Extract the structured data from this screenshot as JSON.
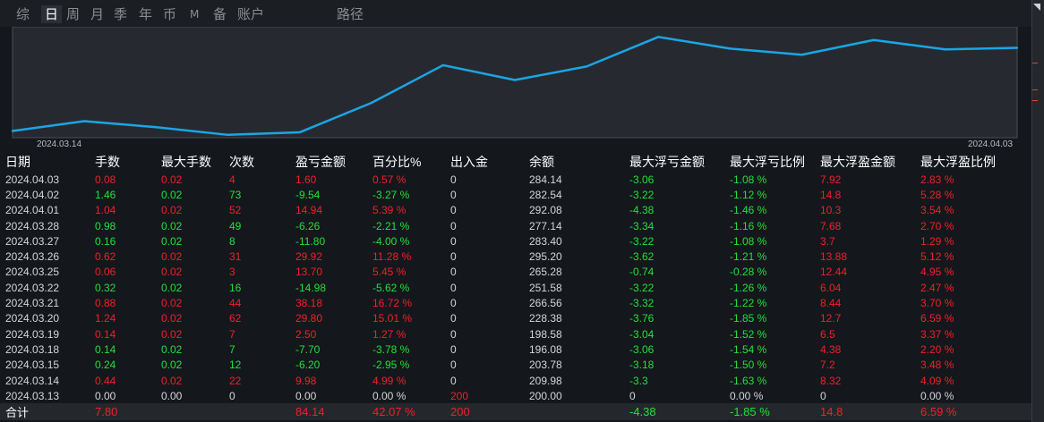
{
  "tabs": [
    "综",
    "日",
    "周",
    "月",
    "季",
    "年",
    "币",
    "M",
    "备",
    "账户",
    "路径"
  ],
  "active_tab": "日",
  "colors": {
    "up": "#f0202a",
    "down": "#23e03a",
    "line": "#1aa6e6",
    "background": "#14171c"
  },
  "chart_data": {
    "type": "line",
    "title": "",
    "xlabel": "",
    "ylabel": "",
    "x_tick_labels": [
      "2024.03.14",
      "2024.04.03"
    ],
    "x": [
      "2024.03.13",
      "2024.03.14",
      "2024.03.15",
      "2024.03.18",
      "2024.03.19",
      "2024.03.20",
      "2024.03.21",
      "2024.03.22",
      "2024.03.25",
      "2024.03.26",
      "2024.03.27",
      "2024.03.28",
      "2024.04.01",
      "2024.04.02",
      "2024.04.03"
    ],
    "series": [
      {
        "values": [
          200.0,
          209.98,
          203.78,
          196.08,
          198.58,
          228.38,
          266.56,
          251.58,
          265.28,
          295.2,
          283.4,
          277.14,
          292.08,
          282.54,
          284.14
        ]
      }
    ],
    "ylim": [
      195,
      300
    ],
    "grid": false,
    "legend": "none"
  },
  "table": {
    "columns": [
      "日期",
      "手数",
      "最大手数",
      "次数",
      "盈亏金额",
      "百分比%",
      "出入金",
      "余额",
      "最大浮亏金额",
      "最大浮亏比例",
      "最大浮盈金额",
      "最大浮盈比例"
    ],
    "rows": [
      [
        "2024.04.03",
        "0.08",
        "0.02",
        "4",
        "1.60",
        "0.57 %",
        "0",
        "284.14",
        "-3.06",
        "-1.08 %",
        "7.92",
        "2.83 %"
      ],
      [
        "2024.04.02",
        "1.46",
        "0.02",
        "73",
        "-9.54",
        "-3.27 %",
        "0",
        "282.54",
        "-3.22",
        "-1.12 %",
        "14.8",
        "5.28 %"
      ],
      [
        "2024.04.01",
        "1.04",
        "0.02",
        "52",
        "14.94",
        "5.39 %",
        "0",
        "292.08",
        "-4.38",
        "-1.46 %",
        "10.3",
        "3.54 %"
      ],
      [
        "2024.03.28",
        "0.98",
        "0.02",
        "49",
        "-6.26",
        "-2.21 %",
        "0",
        "277.14",
        "-3.34",
        "-1.16 %",
        "7.68",
        "2.70 %"
      ],
      [
        "2024.03.27",
        "0.16",
        "0.02",
        "8",
        "-11.80",
        "-4.00 %",
        "0",
        "283.40",
        "-3.22",
        "-1.08 %",
        "3.7",
        "1.29 %"
      ],
      [
        "2024.03.26",
        "0.62",
        "0.02",
        "31",
        "29.92",
        "11.28 %",
        "0",
        "295.20",
        "-3.62",
        "-1.21 %",
        "13.88",
        "5.12 %"
      ],
      [
        "2024.03.25",
        "0.06",
        "0.02",
        "3",
        "13.70",
        "5.45 %",
        "0",
        "265.28",
        "-0.74",
        "-0.28 %",
        "12.44",
        "4.95 %"
      ],
      [
        "2024.03.22",
        "0.32",
        "0.02",
        "16",
        "-14.98",
        "-5.62 %",
        "0",
        "251.58",
        "-3.22",
        "-1.26 %",
        "6.04",
        "2.47 %"
      ],
      [
        "2024.03.21",
        "0.88",
        "0.02",
        "44",
        "38.18",
        "16.72 %",
        "0",
        "266.56",
        "-3.32",
        "-1.22 %",
        "8.44",
        "3.70 %"
      ],
      [
        "2024.03.20",
        "1.24",
        "0.02",
        "62",
        "29.80",
        "15.01 %",
        "0",
        "228.38",
        "-3.76",
        "-1.85 %",
        "12.7",
        "6.59 %"
      ],
      [
        "2024.03.19",
        "0.14",
        "0.02",
        "7",
        "2.50",
        "1.27 %",
        "0",
        "198.58",
        "-3.04",
        "-1.52 %",
        "6.5",
        "3.37 %"
      ],
      [
        "2024.03.18",
        "0.14",
        "0.02",
        "7",
        "-7.70",
        "-3.78 %",
        "0",
        "196.08",
        "-3.06",
        "-1.54 %",
        "4.38",
        "2.20 %"
      ],
      [
        "2024.03.15",
        "0.24",
        "0.02",
        "12",
        "-6.20",
        "-2.95 %",
        "0",
        "203.78",
        "-3.18",
        "-1.50 %",
        "7.2",
        "3.48 %"
      ],
      [
        "2024.03.14",
        "0.44",
        "0.02",
        "22",
        "9.98",
        "4.99 %",
        "0",
        "209.98",
        "-3.3",
        "-1.63 %",
        "8.32",
        "4.09 %"
      ],
      [
        "2024.03.13",
        "0.00",
        "0.00",
        "0",
        "0.00",
        "0.00 %",
        "200",
        "200.00",
        "0",
        "0.00 %",
        "0",
        "0.00 %"
      ]
    ],
    "total": [
      "合计",
      "7.80",
      "",
      "",
      "84.14",
      "42.07 %",
      "200",
      "",
      "-4.38",
      "-1.85 %",
      "14.8",
      "6.59 %"
    ]
  }
}
